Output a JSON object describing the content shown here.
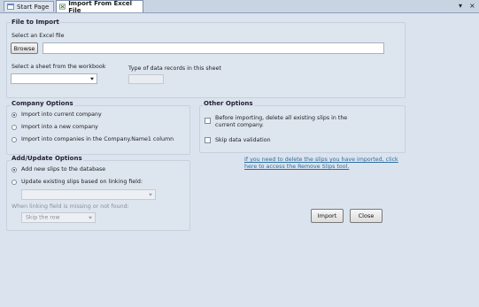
{
  "tabs": [
    {
      "label": "Start Page"
    },
    {
      "label": "Import From Excel File"
    }
  ],
  "window_controls": {
    "dropdown": "▾",
    "close": "×"
  },
  "file_import": {
    "title": "File to Import",
    "select_label": "Select an Excel file",
    "browse_label": "Browse",
    "file_value": "",
    "sheet_label": "Select a sheet from the workbook",
    "sheet_value": "",
    "type_label": "Type of data records in this sheet",
    "type_value": ""
  },
  "company_options": {
    "title": "Company Options",
    "options": [
      {
        "label": "Import into current company",
        "checked": true
      },
      {
        "label": "Import into a new company",
        "checked": false
      },
      {
        "label": "Import into companies in the Company.Name1 column",
        "checked": false
      }
    ]
  },
  "other_options": {
    "title": "Other Options",
    "delete_label_line1": "Before importing, delete all existing  slips in the",
    "delete_label_line2": "current company.",
    "delete_checked": false,
    "skip_label": "Skip data validation",
    "skip_checked": false
  },
  "add_update": {
    "title": "Add/Update Options",
    "opt_add": "Add new slips to the database",
    "opt_add_checked": true,
    "opt_update": "Update existing slips based on linking field:",
    "opt_update_checked": false,
    "linking_value": "",
    "missing_label": "When linking field is missing or not found:",
    "missing_value": "Skip the row"
  },
  "remove_link": {
    "line1": "If you need to delete the slips you have imported, click",
    "line2": "here to access the Remove Slips tool."
  },
  "actions": {
    "import_label": "Import",
    "close_label": "Close"
  }
}
